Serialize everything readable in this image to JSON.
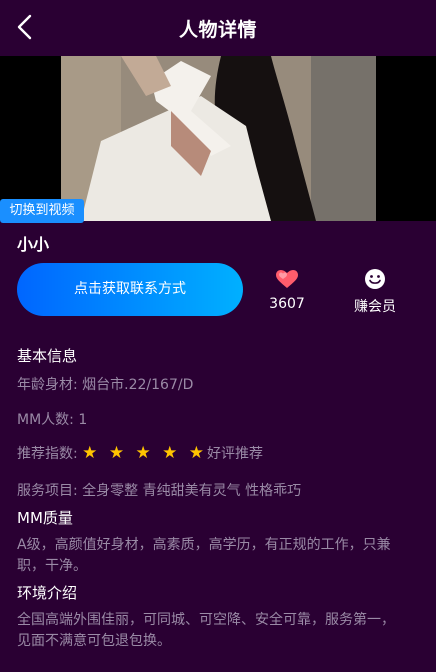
{
  "header": {
    "title": "人物详情",
    "back_icon": "chevron-left-icon"
  },
  "media": {
    "switch_label": "切换到视频"
  },
  "profile": {
    "name": "小小"
  },
  "actions": {
    "contact_label": "点击获取联系方式",
    "likes_icon": "hearts-icon",
    "likes_count": "3607",
    "vip_icon": "smile-icon",
    "vip_label": "赚会员"
  },
  "basic": {
    "title": "基本信息",
    "age_body": "年龄身材: 烟台市.22/167/D",
    "mm_count": "MM人数: 1",
    "rating_label": "推荐指数:",
    "rating_stars": 5,
    "rating_stars_text": "★ ★ ★ ★ ★",
    "rating_text": "好评推荐",
    "services": "服务项目: 全身零整 青纯甜美有灵气 性格乖巧"
  },
  "quality": {
    "title": "MM质量",
    "text": "A级，高颜值好身材，高素质，高学历，有正规的工作，只兼职，干净。"
  },
  "environment": {
    "title": "环境介绍",
    "text": "全国高端外围佳丽，可同城、可空降、安全可靠，服务第一，见面不满意可包退包换。"
  },
  "colors": {
    "background": "#2a0033",
    "button_gradient_start": "#0066ff",
    "button_gradient_end": "#00b0ff",
    "switch_button": "#1a8fff",
    "star": "#ffc400",
    "muted_text": "#9a8aa6"
  }
}
